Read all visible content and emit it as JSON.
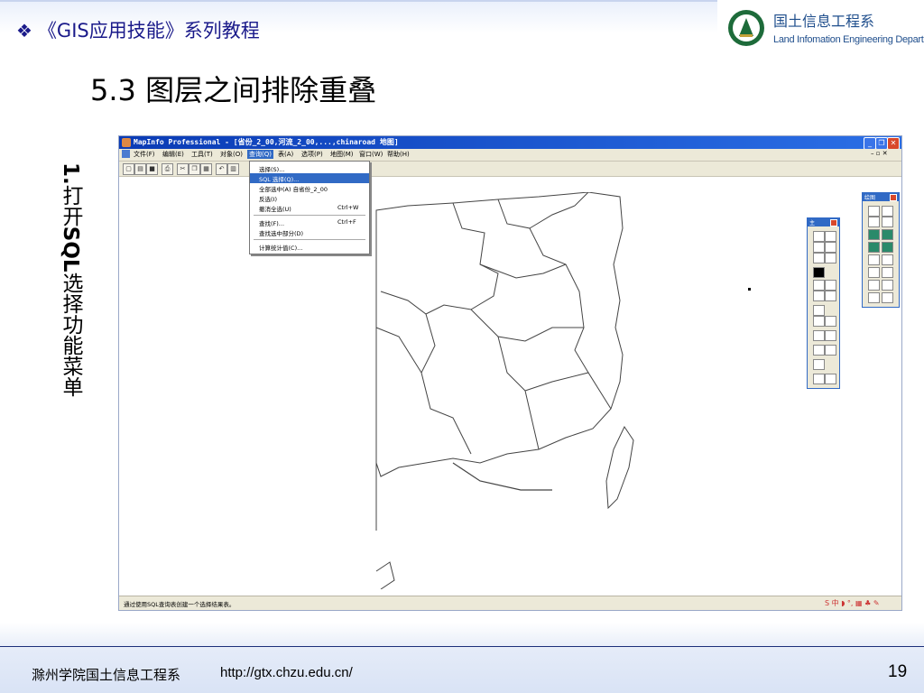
{
  "header": {
    "series_title": "《GIS应用技能》系列教程",
    "bullet_icon": "diamond-bullet-icon",
    "dept_cn": "国土信息工程系",
    "dept_en": "Land Infomation Engineering Department"
  },
  "slide": {
    "title": "5.3 图层之间排除重叠",
    "step_number": "1.",
    "step_text_pre": "打开",
    "step_text_bold": "SQL",
    "step_text_post": "选择功能菜单"
  },
  "app": {
    "window_title": "MapInfo Professional - [省份_2_00,河流_2_00,...,chinaroad 地图]",
    "menu": [
      "文件(F)",
      "编辑(E)",
      "工具(T)",
      "对象(O)",
      "查询(Q)",
      "表(A)",
      "选项(P)",
      "地图(M)",
      "窗口(W)",
      "帮助(H)"
    ],
    "active_menu": "查询(Q)",
    "dropdown": [
      {
        "label": "选择(S)...",
        "shortcut": ""
      },
      {
        "label": "SQL 选择(Q)...",
        "shortcut": ""
      },
      {
        "label": "全部选中(A) 自省份_2_00",
        "shortcut": ""
      },
      {
        "label": "反选(I)",
        "shortcut": ""
      },
      {
        "label": "撤消全选(U)",
        "shortcut": "Ctrl+W"
      },
      {
        "label": "查找(F)...",
        "shortcut": "Ctrl+F"
      },
      {
        "label": "查找选中部分(D)",
        "shortcut": ""
      },
      {
        "label": "计算统计值(C)...",
        "shortcut": ""
      }
    ],
    "highlighted_item": "SQL 选择(Q)...",
    "status_text": "通过使用SQL查询表创建一个选择结果表。",
    "main_palette_title": "主",
    "draw_palette_title": "绘图"
  },
  "footer": {
    "org": "滁州学院国土信息工程系",
    "url": "http://gtx.chzu.edu.cn/",
    "page": "19"
  }
}
